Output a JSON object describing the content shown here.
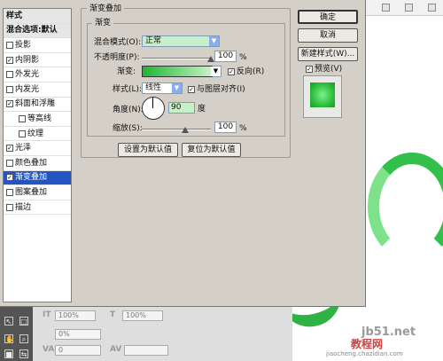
{
  "dialog": {
    "style_list": [
      {
        "label": "样式",
        "header": true
      },
      {
        "label": "混合选项:默认",
        "header": true
      },
      {
        "label": "投影",
        "checked": false
      },
      {
        "label": "内阴影",
        "checked": true
      },
      {
        "label": "外发光",
        "checked": false
      },
      {
        "label": "内发光",
        "checked": false
      },
      {
        "label": "斜面和浮雕",
        "checked": true
      },
      {
        "label": "等高线",
        "checked": false,
        "sub": true
      },
      {
        "label": "纹理",
        "checked": false,
        "sub": true
      },
      {
        "label": "光泽",
        "checked": true
      },
      {
        "label": "颜色叠加",
        "checked": false
      },
      {
        "label": "渐变叠加",
        "checked": true,
        "selected": true
      },
      {
        "label": "图案叠加",
        "checked": false
      },
      {
        "label": "描边",
        "checked": false
      }
    ],
    "panel_title": "渐变叠加",
    "sub_title": "渐变",
    "blend_mode_label": "混合模式(O):",
    "blend_mode_value": "正常",
    "opacity_label": "不透明度(P):",
    "opacity_value": "100",
    "percent": "%",
    "gradient_label": "渐变:",
    "reverse_label": "反向(R)",
    "reverse_checked": true,
    "style_label": "样式(L):",
    "style_value": "线性",
    "align_label": "与图层对齐(I)",
    "align_checked": true,
    "angle_label": "角度(N):",
    "angle_value": "90",
    "degree": "度",
    "scale_label": "缩放(S):",
    "scale_value": "100",
    "set_default_button": "设置为默认值",
    "reset_default_button": "复位为默认值",
    "ok_button": "确定",
    "cancel_button": "取消",
    "new_style_button": "新建样式(W)...",
    "preview_label": "预览(V)",
    "preview_checked": true
  },
  "bottom_toolbar": {
    "tracking_value": "100%",
    "scale_value": "100%",
    "baseline_value": "0%",
    "kerning_value": "0",
    "tt_label": "IT",
    "t_label": "T",
    "va_label": "VA",
    "av_label": "AV"
  },
  "watermark": {
    "site_text": "jb51.net",
    "brand_text": "教程网",
    "url_text": "jiaocheng.chazidian.com"
  }
}
